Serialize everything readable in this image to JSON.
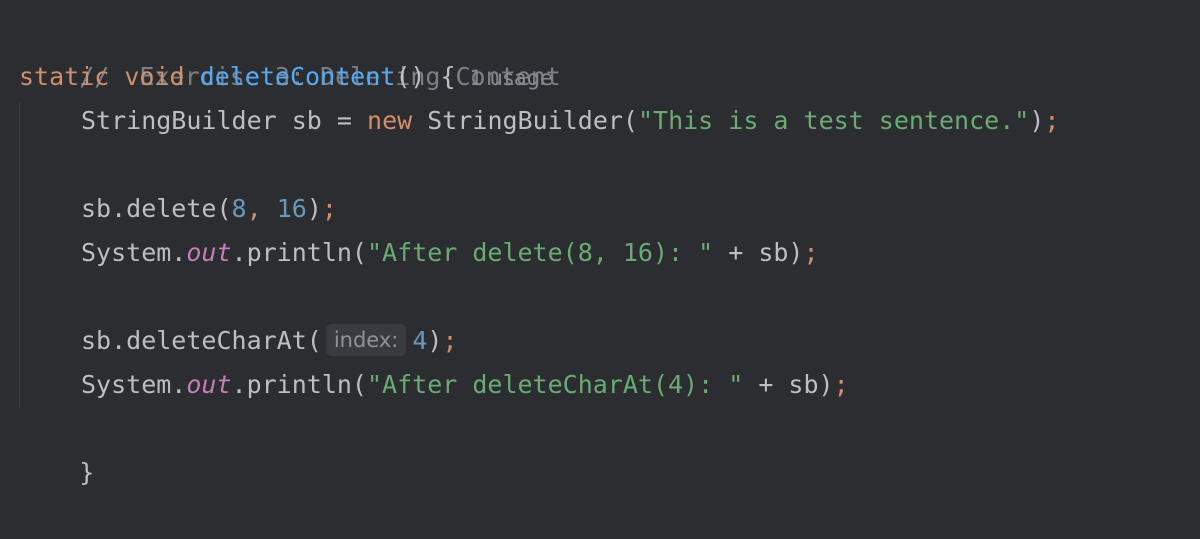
{
  "editor": {
    "lines": {
      "comment": "//  Exercise 3: Deleting Content",
      "signature": {
        "kw_static": "static",
        "kw_void": "void",
        "method_name": "deleteContent",
        "params": "()",
        "brace": "{",
        "usage_hint": "1 usage"
      },
      "decl": {
        "type": "StringBuilder",
        "var": "sb",
        "eq": "=",
        "kw_new": "new",
        "ctor": "StringBuilder(",
        "arg": "\"This is a test sentence.\"",
        "close": ")",
        "semi": ";"
      },
      "delete_call": {
        "prefix": "sb.delete(",
        "arg1": "8",
        "comma": ",",
        "arg2": "16",
        "close": ")",
        "semi": ";"
      },
      "print1": {
        "system": "System.",
        "out": "out",
        "println": ".println(",
        "str": "\"After delete(8, 16): \"",
        "rest": " + sb)",
        "semi": ";"
      },
      "deletecharat_call": {
        "prefix": "sb.deleteCharAt(",
        "param_hint": "index:",
        "arg": "4",
        "close": ")",
        "semi": ";"
      },
      "print2": {
        "system": "System.",
        "out": "out",
        "println": ".println(",
        "str": "\"After deleteCharAt(4): \"",
        "rest": " + sb)",
        "semi": ";"
      },
      "closing_brace": "}"
    }
  },
  "colors": {
    "background": "#2b2d30",
    "keyword": "#cf8e6d",
    "method": "#56a8f5",
    "string": "#6aab73",
    "number": "#6897bb",
    "comment": "#7a7e85",
    "static_field": "#c77dbb",
    "text": "#bcbec4"
  }
}
